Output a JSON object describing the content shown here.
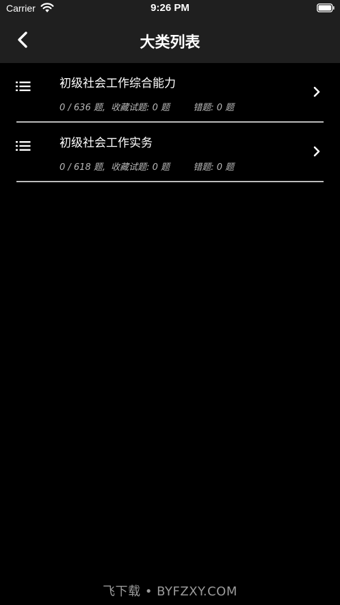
{
  "status_bar": {
    "carrier": "Carrier",
    "time": "9:26 PM",
    "wifi_icon": "wifi-icon",
    "battery_icon": "battery-icon"
  },
  "nav": {
    "title": "大类列表",
    "back_icon": "chevron-left-icon"
  },
  "list": {
    "items": [
      {
        "title": "初级社会工作综合能力",
        "progress": "0 / 636 题,",
        "favorites": "收藏试题: 0 题",
        "errors": "错题: 0 题",
        "icon": "list-icon",
        "chevron": "chevron-right-icon"
      },
      {
        "title": "初级社会工作实务",
        "progress": "0 / 618 题,",
        "favorites": "收藏试题: 0 题",
        "errors": "错题: 0 题",
        "icon": "list-icon",
        "chevron": "chevron-right-icon"
      }
    ]
  },
  "watermark": "飞下载 • BYFZXY.COM",
  "colors": {
    "background": "#000000",
    "bar_background": "#1f1f1f",
    "divider": "#bdbdbd",
    "secondary_text": "#b8b8b8"
  }
}
